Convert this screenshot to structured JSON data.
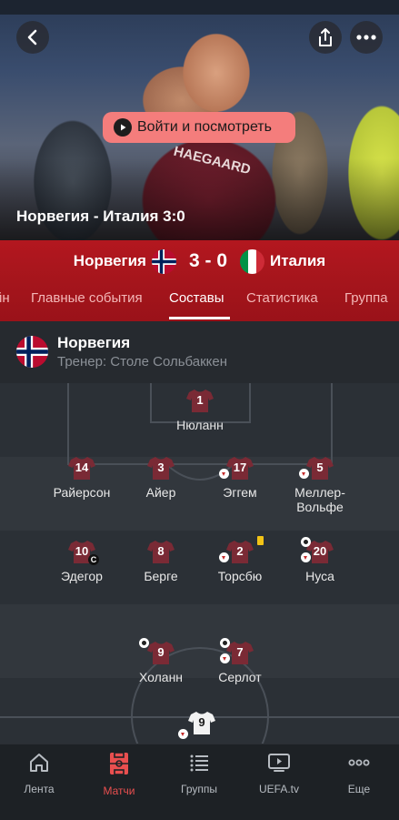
{
  "hero": {
    "title": "Норвегия - Италия 3:0",
    "watch_label": "Войти и посмотреть",
    "shirt_text": "HAEGAARD"
  },
  "scorebar": {
    "home_team": "Норвегия",
    "away_team": "Италия",
    "score": "3 - 0"
  },
  "tabs": [
    {
      "label": "йн"
    },
    {
      "label": "Главные события"
    },
    {
      "label": "Составы"
    },
    {
      "label": "Статистика"
    },
    {
      "label": "Группа"
    }
  ],
  "active_tab": "Составы",
  "lineup": {
    "team": "Норвегия",
    "coach": "Тренер: Столе Сольбаккен",
    "players": [
      {
        "number": "1",
        "name": "Нюланн"
      },
      {
        "number": "14",
        "name": "Райерсон"
      },
      {
        "number": "3",
        "name": "Айер"
      },
      {
        "number": "17",
        "name": "Эггем"
      },
      {
        "number": "5",
        "name": "Меллер-Вольфе"
      },
      {
        "number": "10",
        "name": "Эдегор",
        "badge": "C"
      },
      {
        "number": "8",
        "name": "Берге"
      },
      {
        "number": "2",
        "name": "Торсбю"
      },
      {
        "number": "20",
        "name": "Нуса"
      },
      {
        "number": "9",
        "name": "Холанн"
      },
      {
        "number": "7",
        "name": "Серлот"
      },
      {
        "number": "9"
      }
    ]
  },
  "nav": [
    {
      "label": "Лента",
      "icon": "home-icon"
    },
    {
      "label": "Матчи",
      "icon": "pitch-icon"
    },
    {
      "label": "Группы",
      "icon": "list-icon"
    },
    {
      "label": "UEFA.tv",
      "icon": "tv-icon"
    },
    {
      "label": "Еще",
      "icon": "more-icon"
    }
  ],
  "colors": {
    "accent_red": "#a5151c",
    "watch_button": "#f47d7c",
    "active_nav": "#e94f4f",
    "shirt": "#7a2a35",
    "yellow_card": "#f2c316"
  }
}
